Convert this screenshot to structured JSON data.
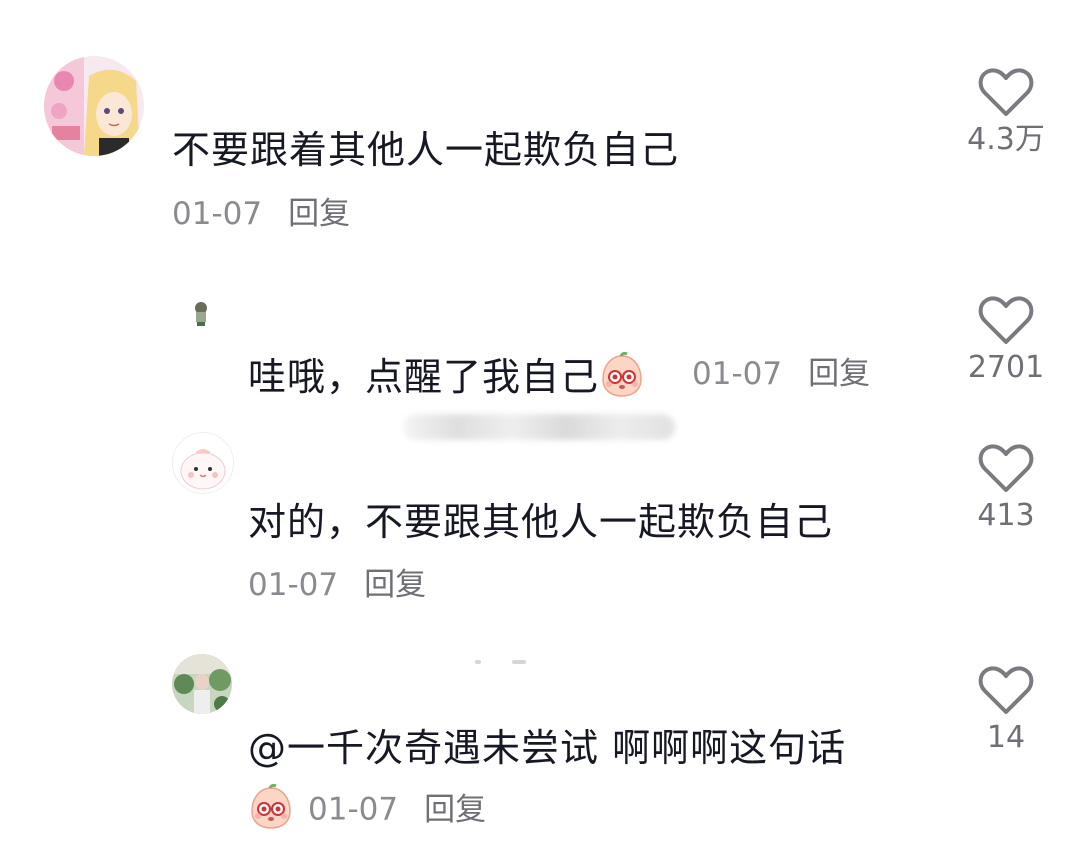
{
  "comments": [
    {
      "text": "不要跟着其他人一起欺负自己",
      "date": "01-07",
      "reply": "回复",
      "likes": "4.3万"
    },
    {
      "text": "哇哦，点醒了我自己",
      "date": "01-07",
      "reply": "回复",
      "likes": "2701"
    },
    {
      "text": "对的，不要跟其他人一起欺负自己",
      "date": "01-07",
      "reply": "回复",
      "likes": "413"
    },
    {
      "text": "@一千次奇遇未尝试  啊啊啊这句话",
      "date": "01-07",
      "reply": "回复",
      "likes": "14"
    }
  ],
  "colors": {
    "text": "#161823",
    "meta": "#8a8b91",
    "heart_stroke": "#7a7b80"
  }
}
